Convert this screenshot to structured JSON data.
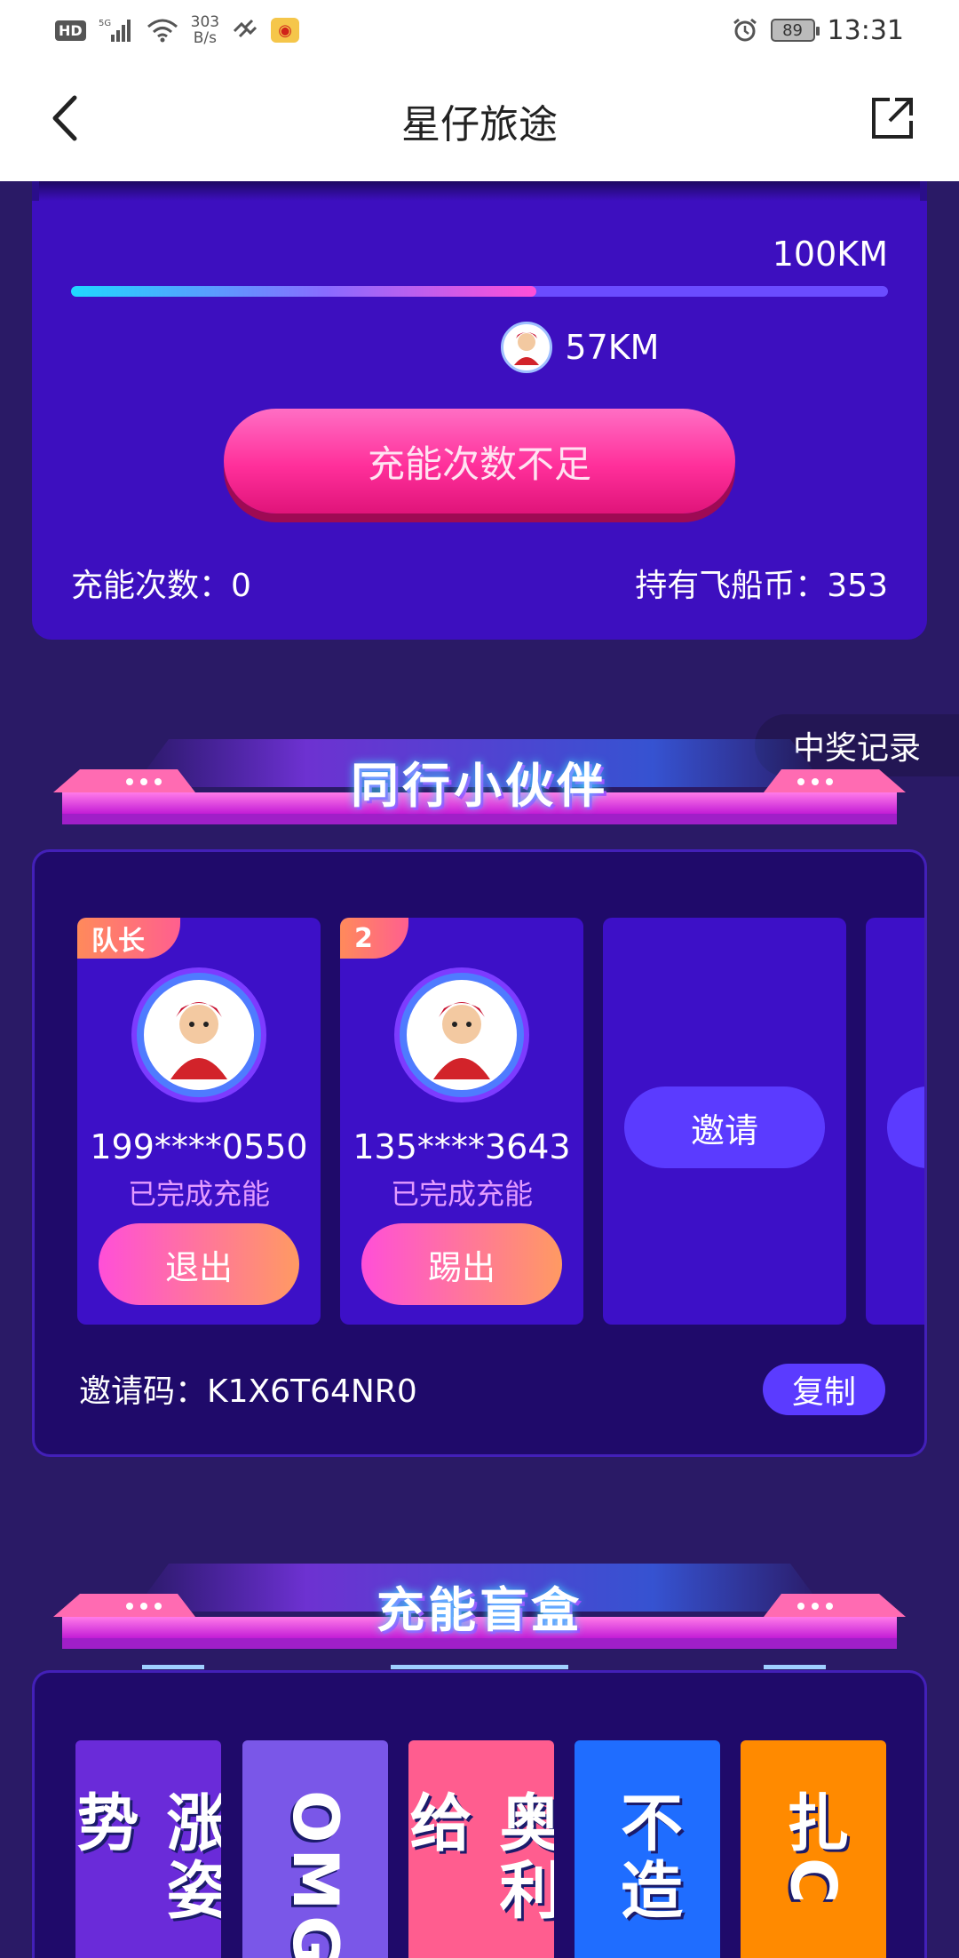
{
  "status_bar": {
    "hd": "HD",
    "signal": "5G",
    "speed_value": "303",
    "speed_unit": "B/s",
    "battery": "89",
    "time": "13:31"
  },
  "nav": {
    "title": "星仔旅途"
  },
  "journey": {
    "total_km": "100KM",
    "current_km": "57KM",
    "progress": 0.57,
    "charge_button": "充能次数不足",
    "charge_count_label": "充能次数：0",
    "coin_label": "持有飞船币：353"
  },
  "prize_record": "中奖记录",
  "partners_section": {
    "title": "同行小伙伴",
    "members": [
      {
        "tag": "队长",
        "phone": "199****0550",
        "status": "已完成充能",
        "action": "退出"
      },
      {
        "tag": "2",
        "phone": "135****3643",
        "status": "已完成充能",
        "action": "踢出"
      }
    ],
    "invite_label": "邀请",
    "invite_code": "邀请码：K1X6T64NR0",
    "copy_label": "复制"
  },
  "blindbox_section": {
    "title": "充能盲盒",
    "boxes": [
      {
        "text": "涨姿势",
        "bg": "#6a2bd9"
      },
      {
        "text": "OMG",
        "bg": "#7a57e8"
      },
      {
        "text": "奥利给",
        "bg": "#ff5d8f"
      },
      {
        "text": "不造",
        "bg": "#1f6dff"
      },
      {
        "text": "扎C",
        "bg": "#ff8a00"
      }
    ]
  },
  "colors": {
    "background": "#2a1a66",
    "card": "#3d0fbf",
    "accent_pink": "#ff2f9a",
    "accent_blue": "#5b3bff"
  }
}
